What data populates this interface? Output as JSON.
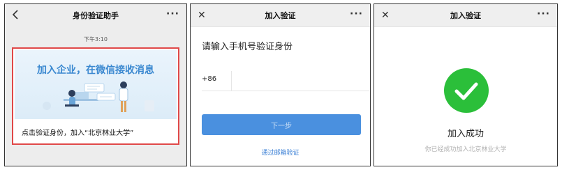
{
  "panel1": {
    "title": "身份验证助手",
    "back_icon": "chevron-left",
    "more_label": "···",
    "timestamp": "下午3:10",
    "banner_title": "加入企业，在微信接收消息",
    "caption": "点击验证身份，加入“北京林业大学”"
  },
  "panel2": {
    "title": "加入验证",
    "close_label": "✕",
    "more_label": "···",
    "prompt": "请输入手机号验证身份",
    "country_code": "+86",
    "phone_value": "",
    "next_label": "下一步",
    "email_link": "通过邮箱验证",
    "accent_color": "#4a90df"
  },
  "panel3": {
    "title": "加入验证",
    "close_label": "✕",
    "more_label": "···",
    "success_title": "加入成功",
    "success_sub": "你已经成功加入北京林业大学",
    "success_color": "#2bbf3a"
  }
}
